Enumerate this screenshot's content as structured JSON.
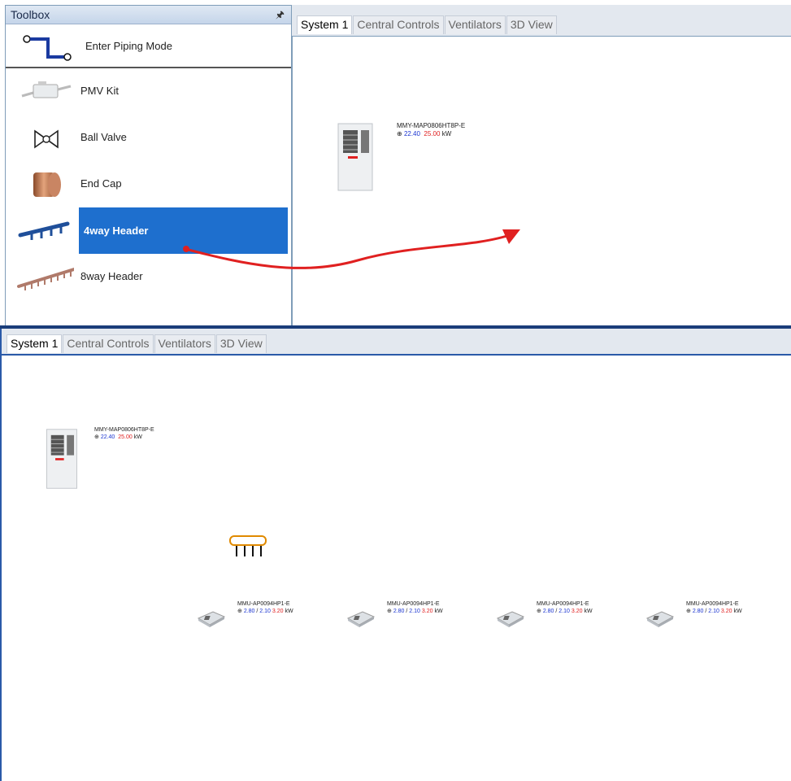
{
  "toolbox": {
    "title": "Toolbox",
    "pin": "📌",
    "piping_label": "Enter Piping Mode",
    "items": [
      {
        "label": "PMV Kit"
      },
      {
        "label": "Ball Valve"
      },
      {
        "label": "End Cap"
      },
      {
        "label": "4way Header",
        "selected": true
      },
      {
        "label": "8way Header"
      }
    ]
  },
  "tabs": [
    "System 1",
    "Central Controls",
    "Ventilators",
    "3D View"
  ],
  "outdoor_unit": {
    "model": "MMY-MAP0806HT8P-E",
    "cool": "22.40",
    "heat": "25.00",
    "unit": "kW"
  },
  "indoor_units": [
    {
      "model": "MMU-AP0094HP1-E",
      "cool": "2.80",
      "sens": "2.10",
      "heat": "3.20",
      "unit": "kW"
    },
    {
      "model": "MMU-AP0094HP1-E",
      "cool": "2.80",
      "sens": "2.10",
      "heat": "3.20",
      "unit": "kW"
    },
    {
      "model": "MMU-AP0094HP1-E",
      "cool": "2.80",
      "sens": "2.10",
      "heat": "3.20",
      "unit": "kW"
    },
    {
      "model": "MMU-AP0094HP1-E",
      "cool": "2.80",
      "sens": "2.10",
      "heat": "3.20",
      "unit": "kW"
    }
  ],
  "colors": {
    "accent": "#1e6fce",
    "arrow": "#e02020",
    "header_icon": "#e08a00"
  }
}
